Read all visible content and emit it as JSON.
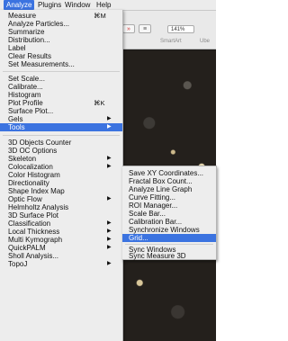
{
  "menubar": {
    "items": [
      {
        "label": "Analyze",
        "active": true
      },
      {
        "label": "Plugins",
        "active": false
      },
      {
        "label": "Window",
        "active": false
      },
      {
        "label": "Help",
        "active": false
      }
    ]
  },
  "background_app": {
    "zoom": "141%",
    "ribbon_label": "SmartArt",
    "ribbon_label_2": "Ube"
  },
  "analyze_menu": {
    "groups": [
      [
        {
          "label": "Measure",
          "shortcut": "⌘M"
        },
        {
          "label": "Analyze Particles..."
        },
        {
          "label": "Summarize"
        },
        {
          "label": "Distribution..."
        },
        {
          "label": "Label"
        },
        {
          "label": "Clear Results"
        },
        {
          "label": "Set Measurements..."
        }
      ],
      [
        {
          "label": "Set Scale..."
        },
        {
          "label": "Calibrate..."
        },
        {
          "label": "Histogram"
        },
        {
          "label": "Plot Profile",
          "shortcut": "⌘K"
        },
        {
          "label": "Surface Plot..."
        },
        {
          "label": "Gels",
          "submenu": true
        },
        {
          "label": "Tools",
          "submenu": true,
          "highlighted": true
        }
      ],
      [
        {
          "label": "3D Objects Counter"
        },
        {
          "label": "3D OC Options"
        },
        {
          "label": "Skeleton",
          "submenu": true
        },
        {
          "label": "Colocalization",
          "submenu": true
        },
        {
          "label": "Color Histogram"
        },
        {
          "label": "Directionality"
        },
        {
          "label": "Shape Index Map"
        },
        {
          "label": "Optic Flow",
          "submenu": true
        },
        {
          "label": "Helmholtz Analysis"
        },
        {
          "label": "3D Surface Plot"
        },
        {
          "label": "Classification",
          "submenu": true
        },
        {
          "label": "Local Thickness",
          "submenu": true
        },
        {
          "label": "Multi Kymograph",
          "submenu": true
        },
        {
          "label": "QuickPALM",
          "submenu": true
        },
        {
          "label": "Sholl Analysis..."
        },
        {
          "label": "TopoJ",
          "submenu": true
        }
      ]
    ]
  },
  "tools_submenu": {
    "groups": [
      [
        {
          "label": "Save XY Coordinates..."
        },
        {
          "label": "Fractal Box Count..."
        },
        {
          "label": "Analyze Line Graph"
        },
        {
          "label": "Curve Fitting..."
        },
        {
          "label": "ROI Manager..."
        },
        {
          "label": "Scale Bar..."
        },
        {
          "label": "Calibration Bar..."
        },
        {
          "label": "Synchronize Windows"
        },
        {
          "label": "Grid...",
          "highlighted": true
        }
      ],
      [
        {
          "label": "Sync Windows"
        },
        {
          "label": "Sync Measure 3D"
        }
      ]
    ]
  },
  "colors": {
    "highlight": "#3b73e0",
    "menu_bg": "#ededed"
  }
}
